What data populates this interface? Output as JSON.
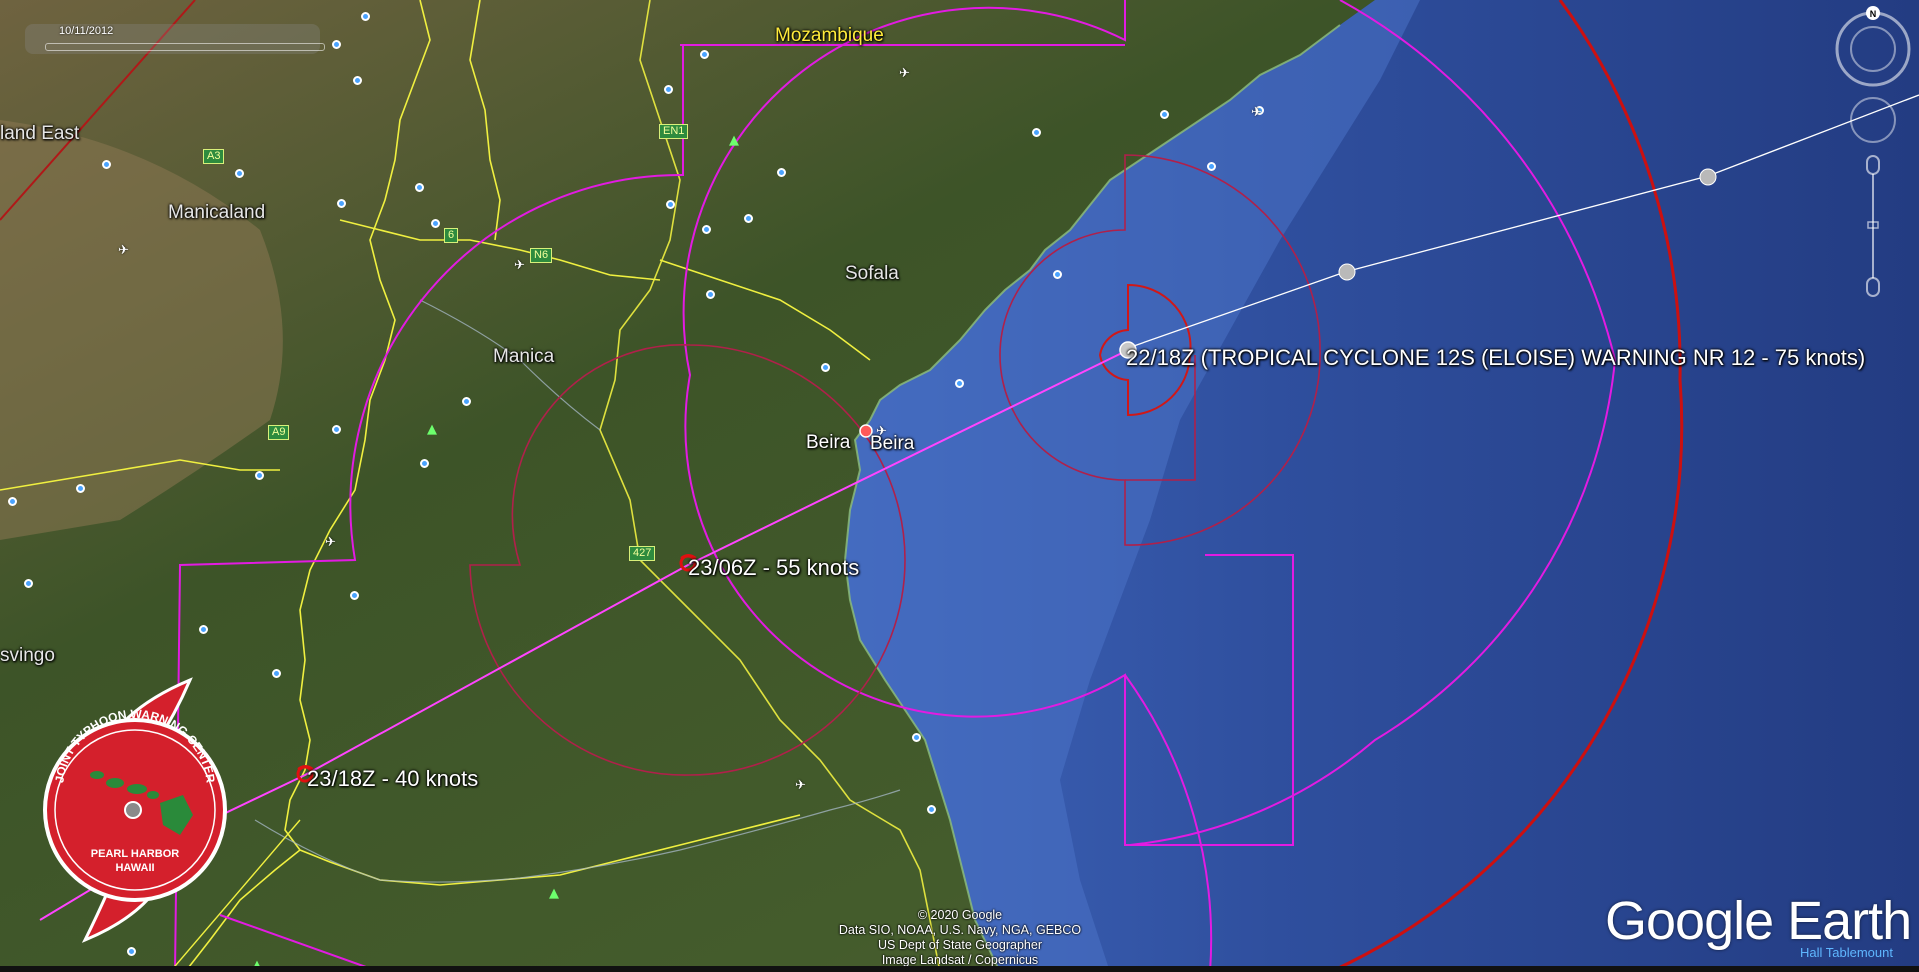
{
  "timeline": {
    "date": "10/11/2012"
  },
  "map_labels": {
    "country": "Mozambique",
    "regions": [
      "Manicaland",
      "Manica",
      "Sofala"
    ],
    "partial_left_top": "land East",
    "partial_left_mid": "svingo",
    "cities": [
      "Beira",
      "Beira"
    ]
  },
  "roads": [
    "A3",
    "EN1",
    "6",
    "N6",
    "A9",
    "427"
  ],
  "forecast_points": [
    {
      "label": "22/18Z (TROPICAL CYCLONE 12S (ELOISE) WARNING NR 12    - 75 knots)"
    },
    {
      "label": "23/06Z - 55 knots"
    },
    {
      "label": "23/18Z - 40 knots"
    }
  ],
  "jtwc_logo": {
    "arc_text": "JOINT TYPHOON WARNING CENTER",
    "line1": "PEARL HARBOR",
    "line2": "HAWAII"
  },
  "navigation": {
    "north_label": "N"
  },
  "attribution": [
    "© 2020 Google",
    "Data SIO, NOAA, U.S. Navy, NGA, GEBCO",
    "US Dept of State Geographer",
    "Image Landsat / Copernicus"
  ],
  "brand": {
    "logo": "Google Earth",
    "credit": "Hall Tablemount"
  },
  "colors": {
    "land": "#3f5a2a",
    "ocean": "#2c4a9a",
    "wind_34kt": "#e21be2",
    "wind_50kt": "#b0204a",
    "danger_arc": "#cc1010",
    "track": "#ff44ff",
    "past_track": "#ffffff",
    "border": "#f0f040",
    "logo_red": "#d4202c"
  }
}
